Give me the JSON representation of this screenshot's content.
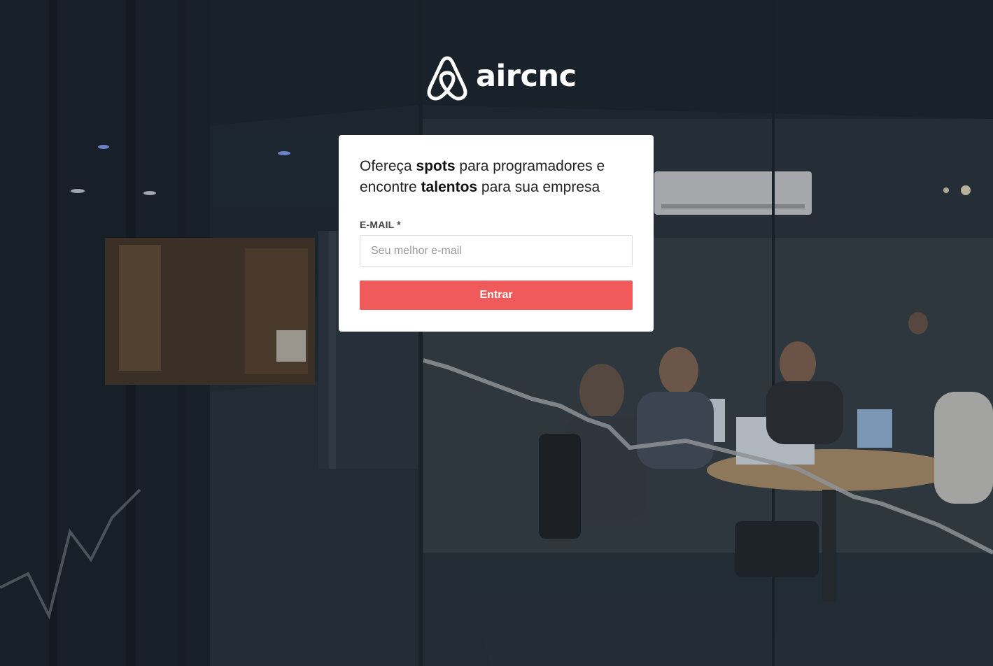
{
  "brand": {
    "name": "aircnc",
    "logo_icon": "airbnb-belo-icon"
  },
  "login": {
    "headline": {
      "part1": "Ofereça ",
      "bold1": "spots",
      "part2": " para programadores e encontre ",
      "bold2": "talentos",
      "part3": " para sua empresa"
    },
    "email_label": "E-MAIL *",
    "email_placeholder": "Seu melhor e-mail",
    "email_value": "",
    "submit_label": "Entrar"
  },
  "colors": {
    "accent": "#f05a5b",
    "card_background": "#ffffff",
    "logo": "#ffffff"
  }
}
